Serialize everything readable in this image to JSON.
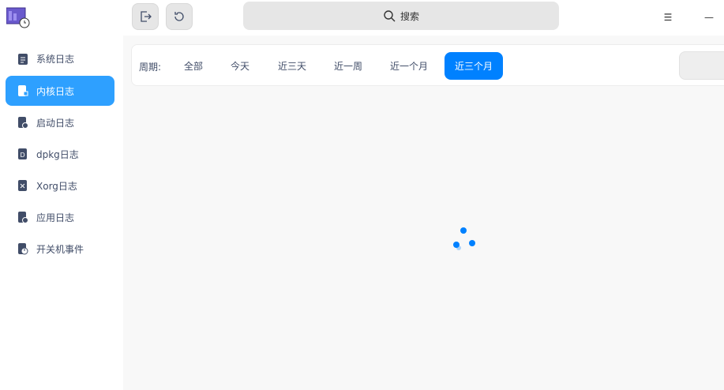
{
  "toolbar": {
    "export_icon": "export-icon",
    "refresh_icon": "refresh-icon",
    "search_placeholder": "搜索",
    "menu_icon": "☰",
    "minimize_icon": "—"
  },
  "sidebar": {
    "items": [
      {
        "label": "系统日志",
        "icon": "clipboard-icon"
      },
      {
        "label": "内核日志",
        "icon": "kernel-log-icon"
      },
      {
        "label": "启动日志",
        "icon": "boot-log-icon"
      },
      {
        "label": "dpkg日志",
        "icon": "dpkg-log-icon"
      },
      {
        "label": "Xorg日志",
        "icon": "xorg-log-icon"
      },
      {
        "label": "应用日志",
        "icon": "app-log-icon"
      },
      {
        "label": "开关机事件",
        "icon": "power-event-icon"
      }
    ],
    "active": 1
  },
  "filter": {
    "label": "周期:",
    "options": [
      "全部",
      "今天",
      "近三天",
      "近一周",
      "近一个月",
      "近三个月"
    ],
    "active": 5
  },
  "colors": {
    "accent": "#0081ff",
    "sidebar_active": "#2ea0ff"
  }
}
